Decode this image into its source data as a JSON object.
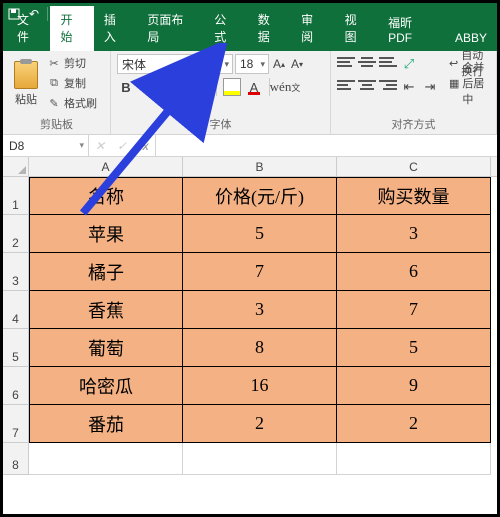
{
  "titlebar": {
    "save_icon": "save-icon",
    "undo_icon": "undo-icon",
    "redo_icon": "redo-icon"
  },
  "ribbon_tabs": {
    "file": "文件",
    "home": "开始",
    "insert": "插入",
    "layout": "页面布局",
    "formulas": "公式",
    "data": "数据",
    "review": "审阅",
    "view": "视图",
    "foxit": "福昕PDF",
    "abbyy": "ABBY"
  },
  "ribbon": {
    "paste": "粘贴",
    "cut": "剪切",
    "copy": "复制",
    "format_painter": "格式刷",
    "clipboard_group": "剪贴板",
    "font_name": "宋体",
    "font_size": "18",
    "font_group": "字体",
    "wrap_text": "自动换行",
    "merge_center": "合并后居中",
    "align_group": "对齐方式"
  },
  "formula_bar": {
    "namebox": "D8",
    "fx": "fx",
    "value": ""
  },
  "columns": {
    "A": "A",
    "B": "B",
    "C": "C"
  },
  "rows": [
    "1",
    "2",
    "3",
    "4",
    "5",
    "6",
    "7",
    "8"
  ],
  "chart_data": {
    "type": "table",
    "headers": [
      "名称",
      "价格(元/斤)",
      "购买数量"
    ],
    "records": [
      {
        "name": "苹果",
        "price": 5,
        "qty": 3
      },
      {
        "name": "橘子",
        "price": 7,
        "qty": 6
      },
      {
        "name": "香蕉",
        "price": 3,
        "qty": 7
      },
      {
        "name": "葡萄",
        "price": 8,
        "qty": 5
      },
      {
        "name": "哈密瓜",
        "price": 16,
        "qty": 9
      },
      {
        "name": "番茄",
        "price": 2,
        "qty": 2
      }
    ]
  }
}
